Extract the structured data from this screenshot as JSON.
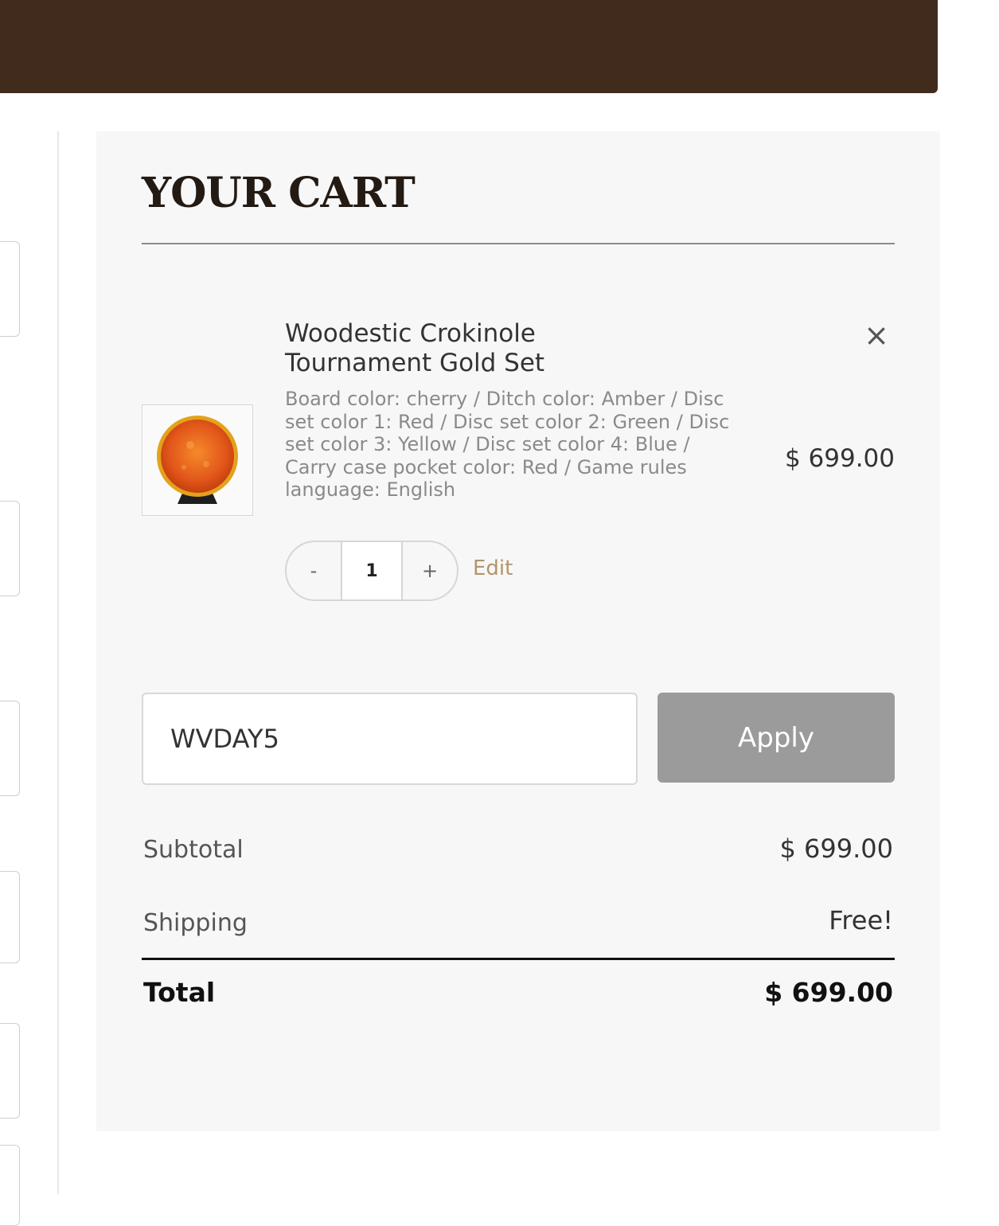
{
  "cart": {
    "title": "YOUR CART",
    "item": {
      "name": "Woodestic Crokinole Tournament Gold Set",
      "options": "Board color: cherry / Ditch color: Amber / Disc set color 1: Red / Disc set color 2: Green / Disc set color 3: Yellow / Disc set color 4: Blue / Carry case pocket color: Red / Game rules language: English",
      "price": "$ 699.00",
      "remove_icon": "×",
      "quantity": "1",
      "decrement": "-",
      "increment": "+",
      "edit_label": "Edit"
    },
    "coupon": {
      "value": "WVDAY5",
      "apply_label": "Apply"
    },
    "summary": {
      "subtotal_label": "Subtotal",
      "subtotal_value": "$ 699.00",
      "shipping_label": "Shipping",
      "shipping_value": "Free!",
      "total_label": "Total",
      "total_value": "$ 699.00"
    }
  },
  "colors": {
    "banner": "#412b1c",
    "cart_background": "#f7f7f7",
    "apply_button": "#9b9b9b",
    "edit_link": "#b4946a"
  }
}
